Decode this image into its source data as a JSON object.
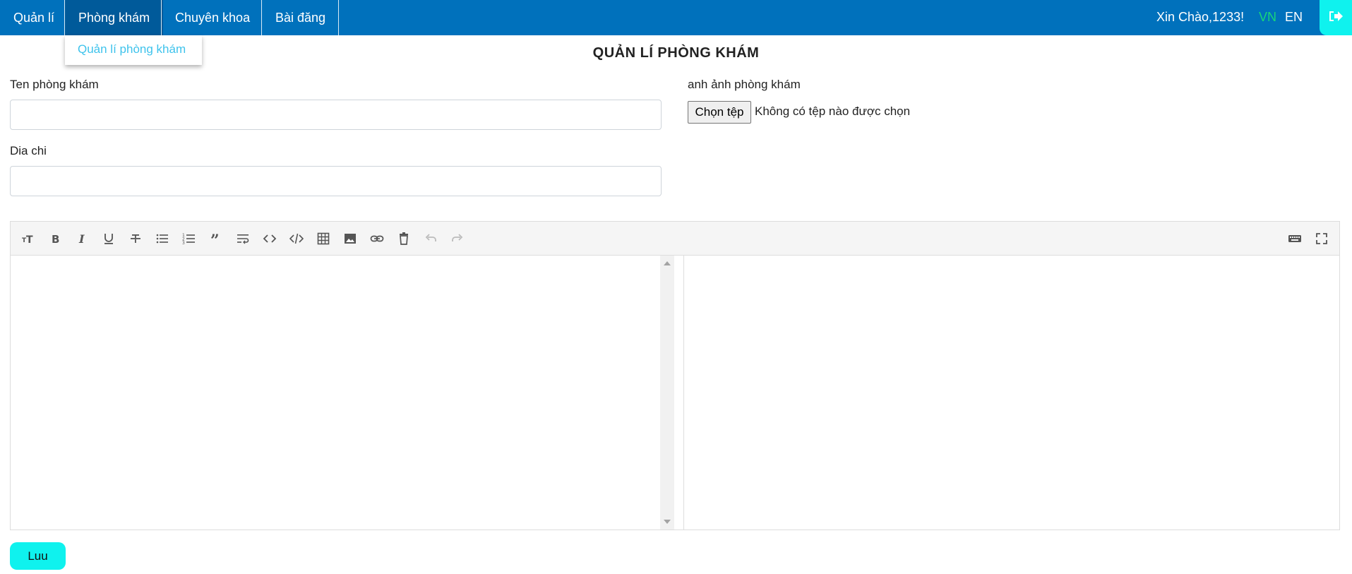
{
  "nav": {
    "items": [
      {
        "label": "Quản lí"
      },
      {
        "label": "Phòng khám"
      },
      {
        "label": "Chuyên khoa"
      },
      {
        "label": "Bài đăng"
      }
    ],
    "greeting": "Xin Chào,1233!",
    "lang_vn": "VN",
    "lang_en": "EN",
    "logout_icon": "logout-icon"
  },
  "dropdown": {
    "items": [
      {
        "label": "Quản lí phòng khám"
      }
    ]
  },
  "page_title": "QUẢN LÍ PHÒNG KHÁM",
  "form": {
    "name_label": "Ten phòng khám",
    "name_value": "",
    "address_label": "Dia chi",
    "address_value": "",
    "image_label": "anh ảnh phòng khám",
    "file_button": "Chọn tệp",
    "file_status": "Không có tệp nào được chọn"
  },
  "editor": {
    "toolbar_left": [
      "header-icon",
      "bold-icon",
      "italic-icon",
      "underline-icon",
      "strikethrough-icon",
      "unordered-list-icon",
      "ordered-list-icon",
      "quote-icon",
      "wrap-icon",
      "inline-code-icon",
      "code-block-icon",
      "table-icon",
      "image-icon",
      "link-icon",
      "clear-icon",
      "undo-icon",
      "redo-icon"
    ],
    "toolbar_right": [
      "keyboard-icon",
      "fullscreen-icon"
    ],
    "content": ""
  },
  "save_button": "Luu",
  "colors": {
    "nav_bg": "#0071bc",
    "accent_cyan": "#0ff2ee",
    "lang_active": "#16d67a",
    "link_blue": "#3ec3ec"
  }
}
